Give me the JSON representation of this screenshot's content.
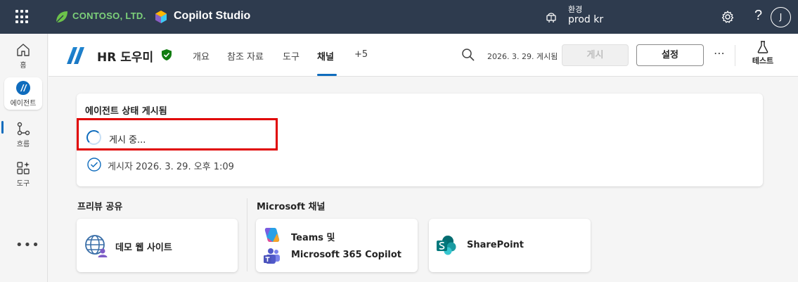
{
  "topbar": {
    "brand": "CONTOSO, LTD.",
    "product": "Copilot Studio",
    "env_label": "환경",
    "env_value": "prod kr",
    "help": "?",
    "avatar": "J"
  },
  "rail": {
    "items": [
      {
        "label": "홈",
        "icon": "home-icon"
      },
      {
        "label": "에이전트",
        "icon": "agent-icon"
      },
      {
        "label": "흐름",
        "icon": "flow-icon"
      },
      {
        "label": "도구",
        "icon": "tools-icon"
      }
    ],
    "more": "•••"
  },
  "header": {
    "agent_name": "HR 도우미",
    "tabs": [
      "개요",
      "참조 자료",
      "도구",
      "채널",
      "+5"
    ],
    "active_tab": "채널",
    "published_date": "2026. 3. 29. 게시됨",
    "publish_label": "게시",
    "settings_label": "설정",
    "more": "⋯",
    "test_label": "테스트"
  },
  "status": {
    "title": "에이전트 상태 게시됨",
    "publishing": "게시 중...",
    "published_by": "게시자 2026. 3. 29. 오후 1:09"
  },
  "preview": {
    "title": "프리뷰 공유",
    "demo_site": "데모 웹 사이트"
  },
  "microsoft": {
    "title": "Microsoft 채널",
    "teams_line1": "Teams 및",
    "teams_line2": "Microsoft 365 Copilot",
    "sharepoint": "SharePoint"
  },
  "colors": {
    "topbar": "#2e3b4e",
    "accent": "#0f6cbd",
    "highlight": "#e00000",
    "brand_green": "#7dd17a"
  }
}
